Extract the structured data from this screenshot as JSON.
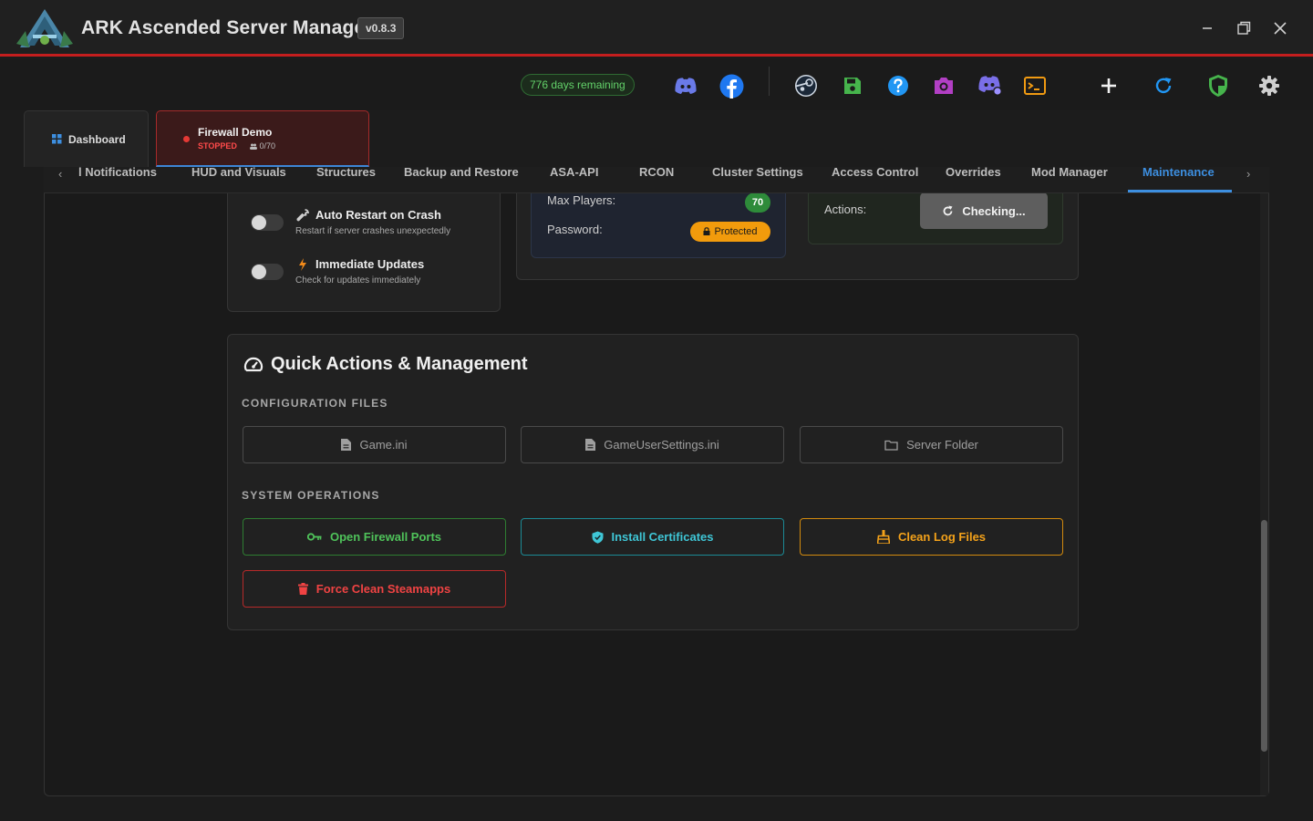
{
  "app": {
    "title": "ARK Ascended Server Manager",
    "version": "v0.8.3"
  },
  "toolbar": {
    "days_remaining": "776 days remaining"
  },
  "server_tabs": {
    "dashboard": "Dashboard",
    "demo": {
      "name": "Firewall Demo",
      "status": "STOPPED",
      "players": "0/70"
    }
  },
  "subtabs": [
    "l Notifications",
    "HUD and Visuals",
    "Structures",
    "Backup and Restore",
    "ASA-API",
    "RCON",
    "Cluster Settings",
    "Access Control",
    "Overrides",
    "Mod Manager",
    "Maintenance"
  ],
  "options": {
    "auto_restart": {
      "title": "Auto Restart on Crash",
      "desc": "Restart if server crashes unexpectedly"
    },
    "immediate_updates": {
      "title": "Immediate Updates",
      "desc": "Check for updates immediately"
    }
  },
  "server_info": {
    "max_players_label": "Max Players:",
    "max_players_value": "70",
    "password_label": "Password:",
    "password_value": "Protected"
  },
  "update_card": {
    "actions_label": "Actions:",
    "checking": "Checking..."
  },
  "quick_actions": {
    "title": "Quick Actions & Management",
    "config_label": "CONFIGURATION FILES",
    "config_buttons": [
      "Game.ini",
      "GameUserSettings.ini",
      "Server Folder"
    ],
    "system_label": "SYSTEM OPERATIONS",
    "open_firewall": "Open Firewall Ports",
    "install_certs": "Install Certificates",
    "clean_logs": "Clean Log Files",
    "force_clean": "Force Clean Steamapps"
  },
  "colors": {
    "accent": "#3d8fe0",
    "brand_red": "#c41e1e",
    "success": "#4fc35a",
    "warning": "#f4a21a",
    "danger": "#f04343",
    "info": "#3fc6d6"
  }
}
